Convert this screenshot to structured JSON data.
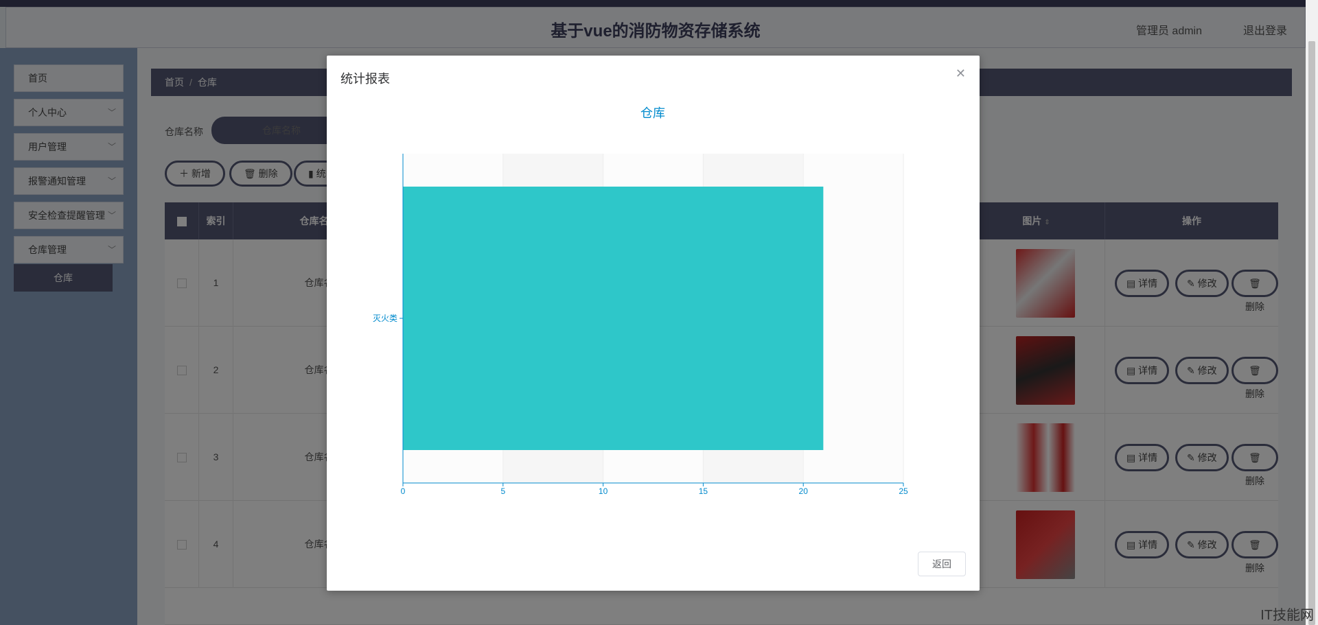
{
  "header": {
    "title": "基于vue的消防物资存储系统",
    "user": "管理员 admin",
    "logout": "退出登录"
  },
  "sidebar": {
    "items": [
      {
        "label": "首页",
        "has_chevron": false
      },
      {
        "label": "个人中心",
        "has_chevron": true
      },
      {
        "label": "用户管理",
        "has_chevron": true
      },
      {
        "label": "报警通知管理",
        "has_chevron": true
      },
      {
        "label": "安全检查提醒管理",
        "has_chevron": true
      },
      {
        "label": "仓库管理",
        "has_chevron": true
      }
    ],
    "active_sub": "仓库"
  },
  "breadcrumb": {
    "home": "首页",
    "sep": "/",
    "current": "仓库"
  },
  "search": {
    "label": "仓库名称",
    "placeholder": "仓库名称"
  },
  "toolbar": {
    "add": "新增",
    "delete": "删除",
    "stats": "统"
  },
  "table": {
    "headers": {
      "index": "索引",
      "name": "仓库名称",
      "image": "图片",
      "actions": "操作"
    },
    "rows": [
      {
        "index": "1",
        "name": "仓库名"
      },
      {
        "index": "2",
        "name": "仓库名"
      },
      {
        "index": "3",
        "name": "仓库名"
      },
      {
        "index": "4",
        "name": "仓库名"
      }
    ],
    "actions": {
      "detail": "详情",
      "edit": "修改",
      "delete": "删除"
    }
  },
  "dialog": {
    "title": "统计报表",
    "back": "返回"
  },
  "chart_data": {
    "type": "bar",
    "orientation": "horizontal",
    "title": "仓库",
    "categories": [
      "灭火类"
    ],
    "values": [
      21
    ],
    "xlim": [
      0,
      25
    ],
    "xticks": [
      0,
      5,
      10,
      15,
      20,
      25
    ],
    "bar_color": "#2ec7c9",
    "axis_color": "#008acd",
    "split_area": true
  },
  "watermark": "IT技能网",
  "colors": {
    "accent": "#555875",
    "topbar": "#3d3f5c"
  }
}
